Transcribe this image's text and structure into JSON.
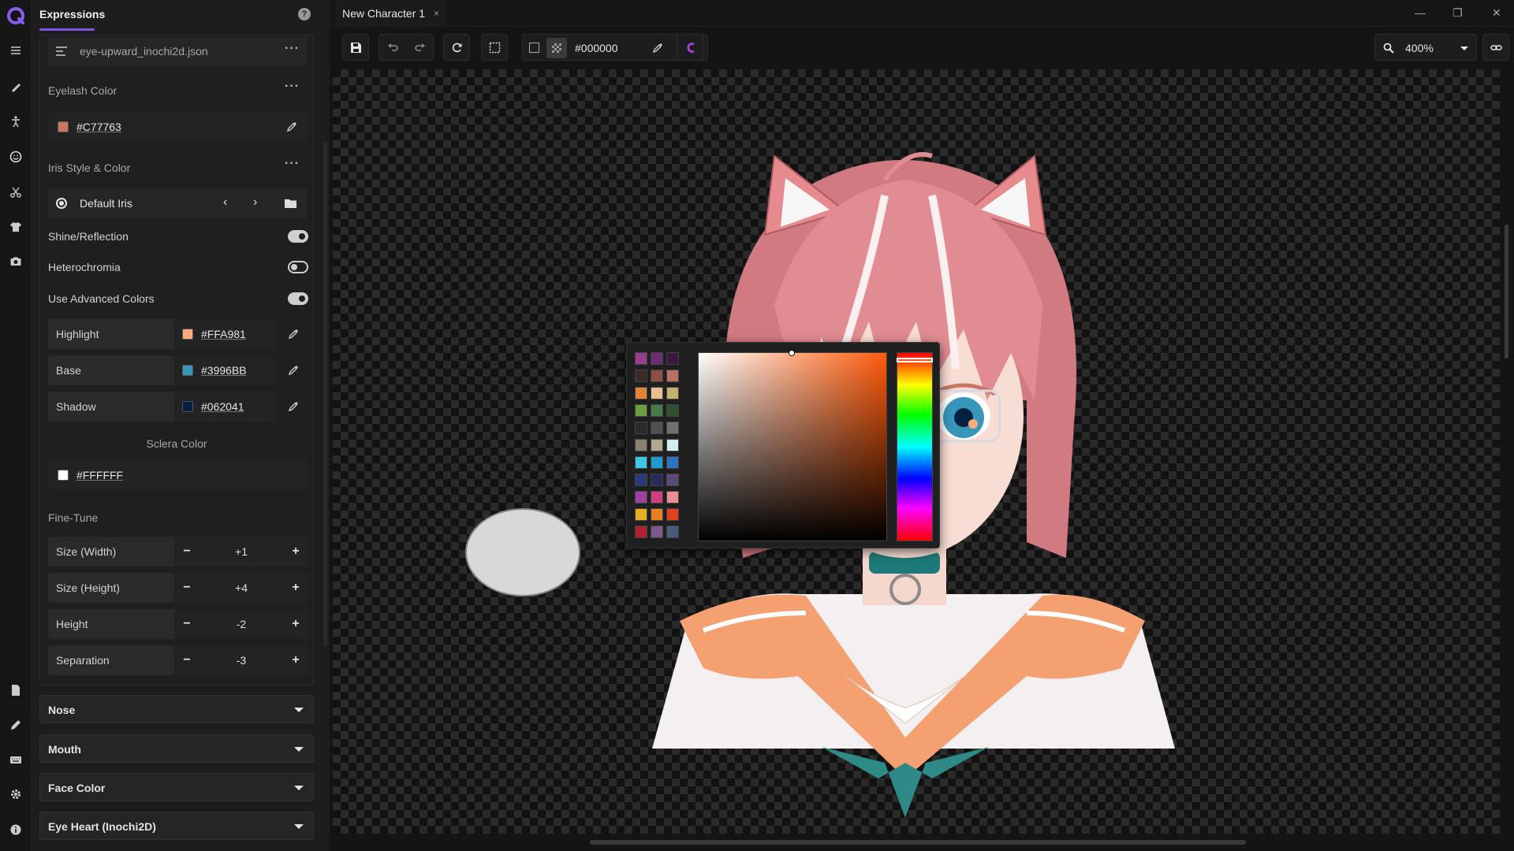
{
  "panel": {
    "title": "Expressions",
    "file": "eye-upward_inochi2d.json",
    "eyelash": {
      "label": "Eyelash Color",
      "hex": "#C77763",
      "swatch": "#C77763"
    },
    "iris": {
      "label": "Iris Style & Color",
      "style": "Default Iris"
    },
    "toggles": [
      {
        "label": "Shine/Reflection",
        "on": true
      },
      {
        "label": "Heterochromia",
        "on": false
      },
      {
        "label": "Use Advanced Colors",
        "on": true
      }
    ],
    "advanced": [
      {
        "name": "Highlight",
        "hex": "#FFA981",
        "swatch": "#FFA981"
      },
      {
        "name": "Base",
        "hex": "#3996BB",
        "swatch": "#3996BB"
      },
      {
        "name": "Shadow",
        "hex": "#062041",
        "swatch": "#062041"
      }
    ],
    "sclera": {
      "label": "Sclera Color",
      "hex": "#FFFFFF",
      "swatch": "#FFFFFF"
    },
    "finetune": {
      "label": "Fine-Tune",
      "rows": [
        {
          "name": "Size (Width)",
          "value": "+1"
        },
        {
          "name": "Size (Height)",
          "value": "+4"
        },
        {
          "name": "Height",
          "value": "-2"
        },
        {
          "name": "Separation",
          "value": "-3"
        }
      ]
    },
    "sections": [
      "Nose",
      "Mouth",
      "Face Color",
      "Eye Heart (Inochi2D)"
    ]
  },
  "tab": {
    "name": "New Character 1",
    "close": "×"
  },
  "toolbar": {
    "bg_hex": "#000000",
    "zoom": "400%"
  },
  "window": {
    "minimize": "—",
    "restore": "❐",
    "close": "✕"
  },
  "picker": {
    "palette": [
      "#9B3D8F",
      "#6B2C73",
      "#3A1A3F",
      "#3A2A2A",
      "#8C5040",
      "#B87060",
      "#E0863A",
      "#E8C090",
      "#C4B070",
      "#6BA040",
      "#4A7A4A",
      "#305030",
      "#2A2A2A",
      "#505050",
      "#707070",
      "#8A8070",
      "#B0A890",
      "#D0F0F0",
      "#40C8E0",
      "#2098D0",
      "#3070C0",
      "#2A3A7A",
      "#2A2A5A",
      "#5A4A7A",
      "#A040A0",
      "#D04080",
      "#E89090",
      "#E8B020",
      "#E88020",
      "#E04020",
      "#B02030",
      "#7A5A8A",
      "#4A5A7A"
    ],
    "hue_color": "#FF5A0A"
  },
  "colors": {
    "accent": "#7C55E0",
    "logo": "#8A5CF0"
  }
}
